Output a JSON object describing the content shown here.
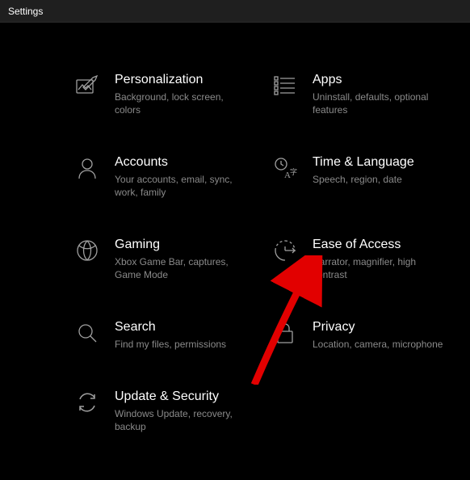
{
  "window": {
    "title": "Settings"
  },
  "tiles": [
    {
      "title": "Personalization",
      "desc": "Background, lock screen, colors"
    },
    {
      "title": "Apps",
      "desc": "Uninstall, defaults, optional features"
    },
    {
      "title": "Accounts",
      "desc": "Your accounts, email, sync, work, family"
    },
    {
      "title": "Time & Language",
      "desc": "Speech, region, date"
    },
    {
      "title": "Gaming",
      "desc": "Xbox Game Bar, captures, Game Mode"
    },
    {
      "title": "Ease of Access",
      "desc": "Narrator, magnifier, high contrast"
    },
    {
      "title": "Search",
      "desc": "Find my files, permissions"
    },
    {
      "title": "Privacy",
      "desc": "Location, camera, microphone"
    },
    {
      "title": "Update & Security",
      "desc": "Windows Update, recovery, backup"
    }
  ]
}
